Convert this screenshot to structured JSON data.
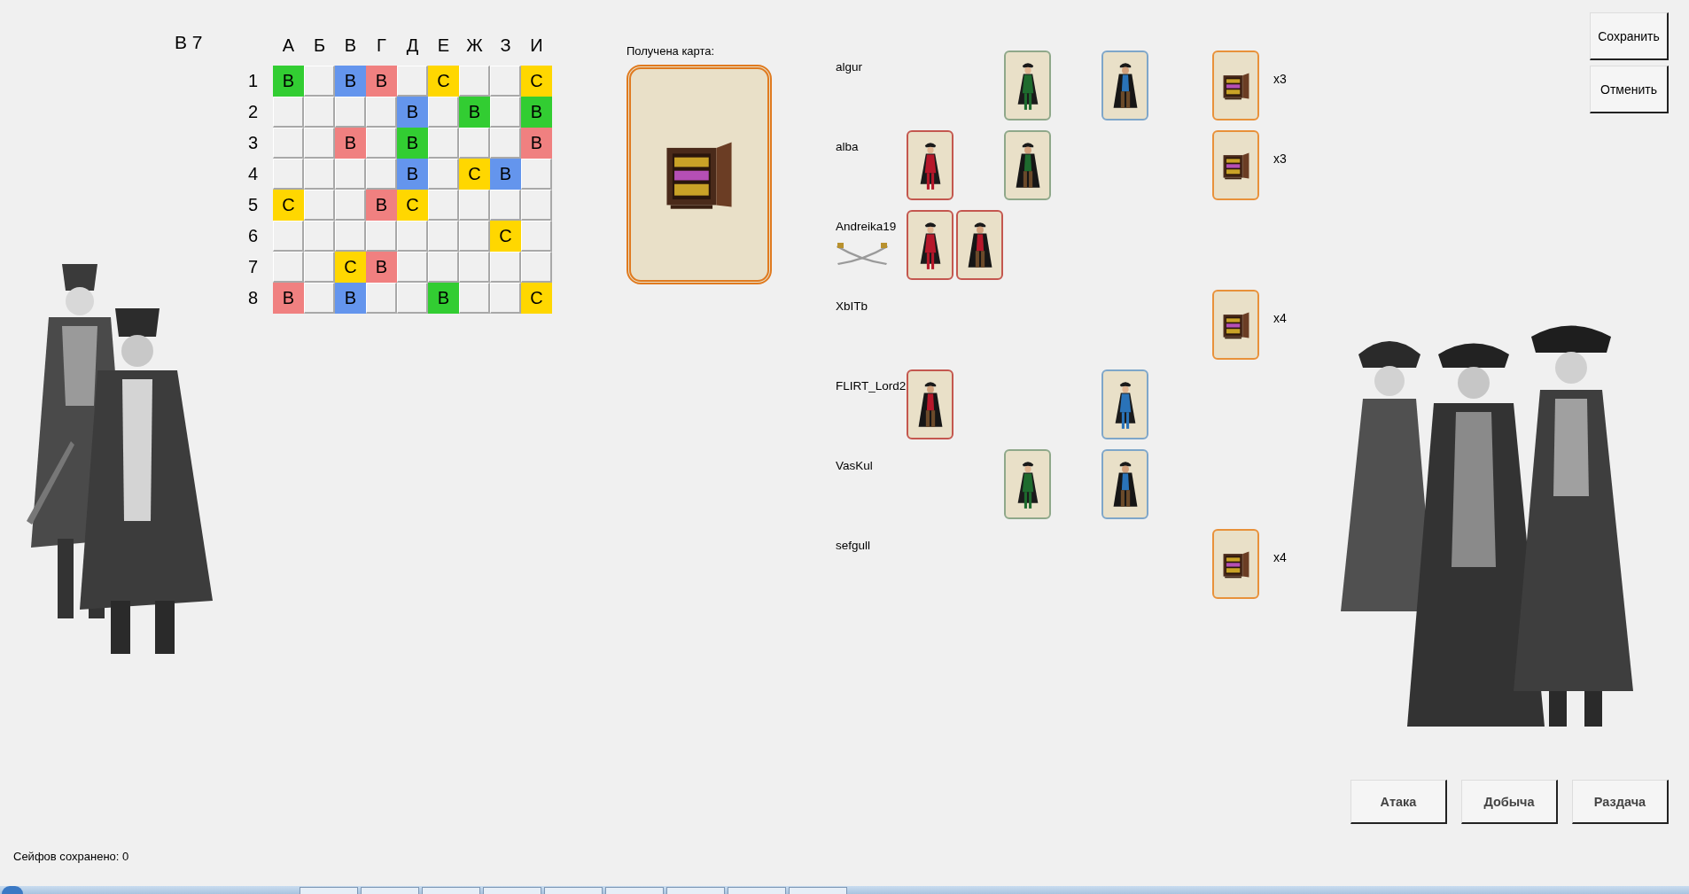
{
  "turn_label": "В 7",
  "grid": {
    "columns": [
      "А",
      "Б",
      "В",
      "Г",
      "Д",
      "Е",
      "Ж",
      "З",
      "И"
    ],
    "rows": [
      {
        "label": "1",
        "cells": [
          {
            "kind": "mark",
            "text": "В",
            "color": "#32cd32"
          },
          {
            "kind": "empty"
          },
          {
            "kind": "mark",
            "text": "В",
            "color": "#6495ed"
          },
          {
            "kind": "mark",
            "text": "В",
            "color": "#f08080"
          },
          {
            "kind": "empty"
          },
          {
            "kind": "mark",
            "text": "С",
            "color": "#ffd700"
          },
          {
            "kind": "empty"
          },
          {
            "kind": "empty"
          },
          {
            "kind": "mark",
            "text": "С",
            "color": "#ffd700"
          }
        ]
      },
      {
        "label": "2",
        "cells": [
          {
            "kind": "empty"
          },
          {
            "kind": "empty"
          },
          {
            "kind": "empty"
          },
          {
            "kind": "empty"
          },
          {
            "kind": "mark",
            "text": "В",
            "color": "#6495ed"
          },
          {
            "kind": "empty"
          },
          {
            "kind": "mark",
            "text": "В",
            "color": "#32cd32"
          },
          {
            "kind": "empty"
          },
          {
            "kind": "mark",
            "text": "В",
            "color": "#32cd32"
          }
        ]
      },
      {
        "label": "3",
        "cells": [
          {
            "kind": "empty"
          },
          {
            "kind": "empty"
          },
          {
            "kind": "mark",
            "text": "В",
            "color": "#f08080"
          },
          {
            "kind": "empty"
          },
          {
            "kind": "mark",
            "text": "В",
            "color": "#32cd32"
          },
          {
            "kind": "empty"
          },
          {
            "kind": "empty"
          },
          {
            "kind": "empty"
          },
          {
            "kind": "mark",
            "text": "В",
            "color": "#f08080"
          }
        ]
      },
      {
        "label": "4",
        "cells": [
          {
            "kind": "empty"
          },
          {
            "kind": "empty"
          },
          {
            "kind": "empty"
          },
          {
            "kind": "empty"
          },
          {
            "kind": "mark",
            "text": "В",
            "color": "#6495ed"
          },
          {
            "kind": "empty"
          },
          {
            "kind": "mark",
            "text": "С",
            "color": "#ffd700"
          },
          {
            "kind": "mark",
            "text": "В",
            "color": "#6495ed"
          },
          {
            "kind": "empty"
          }
        ]
      },
      {
        "label": "5",
        "cells": [
          {
            "kind": "mark",
            "text": "С",
            "color": "#ffd700"
          },
          {
            "kind": "empty"
          },
          {
            "kind": "empty"
          },
          {
            "kind": "mark",
            "text": "В",
            "color": "#f08080"
          },
          {
            "kind": "mark",
            "text": "С",
            "color": "#ffd700"
          },
          {
            "kind": "empty"
          },
          {
            "kind": "empty"
          },
          {
            "kind": "empty"
          },
          {
            "kind": "empty"
          }
        ]
      },
      {
        "label": "6",
        "cells": [
          {
            "kind": "empty"
          },
          {
            "kind": "empty"
          },
          {
            "kind": "empty"
          },
          {
            "kind": "empty"
          },
          {
            "kind": "empty"
          },
          {
            "kind": "empty"
          },
          {
            "kind": "empty"
          },
          {
            "kind": "mark",
            "text": "С",
            "color": "#ffd700"
          },
          {
            "kind": "empty"
          }
        ]
      },
      {
        "label": "7",
        "cells": [
          {
            "kind": "empty"
          },
          {
            "kind": "empty"
          },
          {
            "kind": "mark",
            "text": "С",
            "color": "#ffd700"
          },
          {
            "kind": "mark",
            "text": "В",
            "color": "#f08080"
          },
          {
            "kind": "empty"
          },
          {
            "kind": "empty"
          },
          {
            "kind": "empty"
          },
          {
            "kind": "empty"
          },
          {
            "kind": "empty"
          }
        ]
      },
      {
        "label": "8",
        "cells": [
          {
            "kind": "mark",
            "text": "В",
            "color": "#f08080"
          },
          {
            "kind": "empty"
          },
          {
            "kind": "mark",
            "text": "В",
            "color": "#6495ed"
          },
          {
            "kind": "empty"
          },
          {
            "kind": "empty"
          },
          {
            "kind": "mark",
            "text": "В",
            "color": "#32cd32"
          },
          {
            "kind": "empty"
          },
          {
            "kind": "empty"
          },
          {
            "kind": "mark",
            "text": "С",
            "color": "#ffd700"
          }
        ]
      }
    ]
  },
  "received_card": {
    "label": "Получена карта:",
    "kind": "safe"
  },
  "players": [
    {
      "name": "algur",
      "attacking": false,
      "green": [
        {
          "kind": "woman"
        }
      ],
      "blue": [
        {
          "kind": "man"
        }
      ],
      "safes": {
        "count": "x3"
      }
    },
    {
      "name": "alba",
      "attacking": false,
      "red": [
        {
          "kind": "woman"
        }
      ],
      "green": [
        {
          "kind": "man"
        }
      ],
      "safes": {
        "count": "x3"
      }
    },
    {
      "name": "Andreika19",
      "attacking": true,
      "red": [
        {
          "kind": "woman"
        },
        {
          "kind": "man"
        }
      ]
    },
    {
      "name": "XbITb",
      "attacking": false,
      "safes": {
        "count": "x4"
      }
    },
    {
      "name": "FLIRT_Lord2",
      "attacking": false,
      "red": [
        {
          "kind": "man"
        }
      ],
      "blue": [
        {
          "kind": "woman"
        }
      ]
    },
    {
      "name": "VasKul",
      "attacking": false,
      "green": [
        {
          "kind": "woman"
        }
      ],
      "blue": [
        {
          "kind": "man"
        }
      ]
    },
    {
      "name": "sefgull",
      "attacking": false,
      "safes": {
        "count": "x4"
      }
    }
  ],
  "top_buttons": [
    "Сохранить",
    "Отменить"
  ],
  "action_buttons": [
    "Атака",
    "Добыча",
    "Раздача"
  ],
  "status": "Сейфов сохранено: 0"
}
